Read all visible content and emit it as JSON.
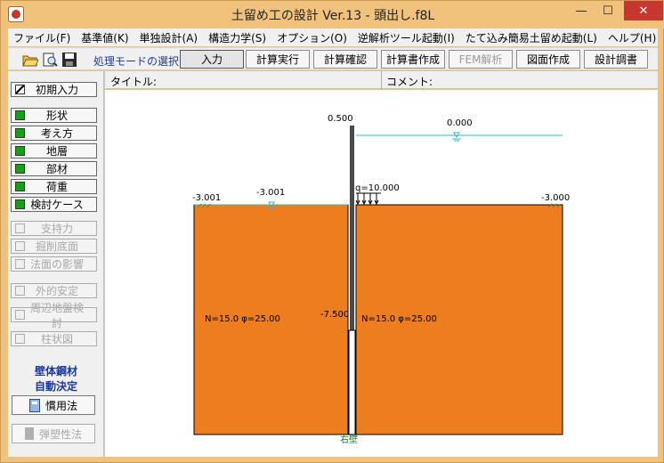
{
  "window": {
    "title": "土留め工の設計 Ver.13 - 頭出し.f8L",
    "controls": {
      "minimize": "—",
      "maximize": "☐",
      "close": "✕"
    }
  },
  "menu": [
    "ファイル(F)",
    "基準値(K)",
    "単独設計(A)",
    "構造力学(S)",
    "オプション(O)",
    "逆解析ツール起動(I)",
    "たて込み簡易土留め起動(L)",
    "ヘルプ(H)"
  ],
  "toolbar": {
    "mode_label": "処理モードの選択",
    "buttons": [
      {
        "label": "入力",
        "state": "pressed"
      },
      {
        "label": "計算実行",
        "state": "normal"
      },
      {
        "label": "計算確認",
        "state": "normal"
      },
      {
        "label": "計算書作成",
        "state": "normal"
      },
      {
        "label": "FEM解析",
        "state": "disabled"
      },
      {
        "label": "図面作成",
        "state": "normal"
      },
      {
        "label": "設計調書",
        "state": "normal"
      }
    ]
  },
  "sidebar": {
    "initial_input": "初期入力",
    "items": [
      {
        "label": "形状",
        "state": "green"
      },
      {
        "label": "考え方",
        "state": "green"
      },
      {
        "label": "地層",
        "state": "green"
      },
      {
        "label": "部材",
        "state": "green"
      },
      {
        "label": "荷重",
        "state": "green"
      },
      {
        "label": "検討ケース",
        "state": "green"
      },
      {
        "label": "支持力",
        "state": "disabled"
      },
      {
        "label": "掘削底面",
        "state": "disabled"
      },
      {
        "label": "法面の影響",
        "state": "disabled"
      },
      {
        "label": "外的安定",
        "state": "disabled"
      },
      {
        "label": "周辺地盤検討",
        "state": "disabled"
      },
      {
        "label": "柱状図",
        "state": "disabled"
      }
    ],
    "wall_note_1": "壁体鋼材",
    "wall_note_2": "自動決定",
    "method_conventional": "慣用法",
    "method_elastoplastic": "弾塑性法"
  },
  "infobar": {
    "title_label": "タイトル:",
    "comment_label": "コメント:"
  },
  "drawing": {
    "wall_top": "0.500",
    "water_right": "0.000",
    "ground_left": "-3.001",
    "water_left": "-3.001",
    "ground_right": "-3.000",
    "surcharge": "q=10.000",
    "wall_bottom": "-7.500",
    "soil_left": "N=15.0  φ=25.00",
    "soil_right": "N=15.0  φ=25.00",
    "wall_label": "右壁",
    "colors": {
      "soil": "#ee7d1f",
      "water": "#35b7c0",
      "wall": "#4a4a4a",
      "wall_label": "#1f7a2a"
    }
  }
}
